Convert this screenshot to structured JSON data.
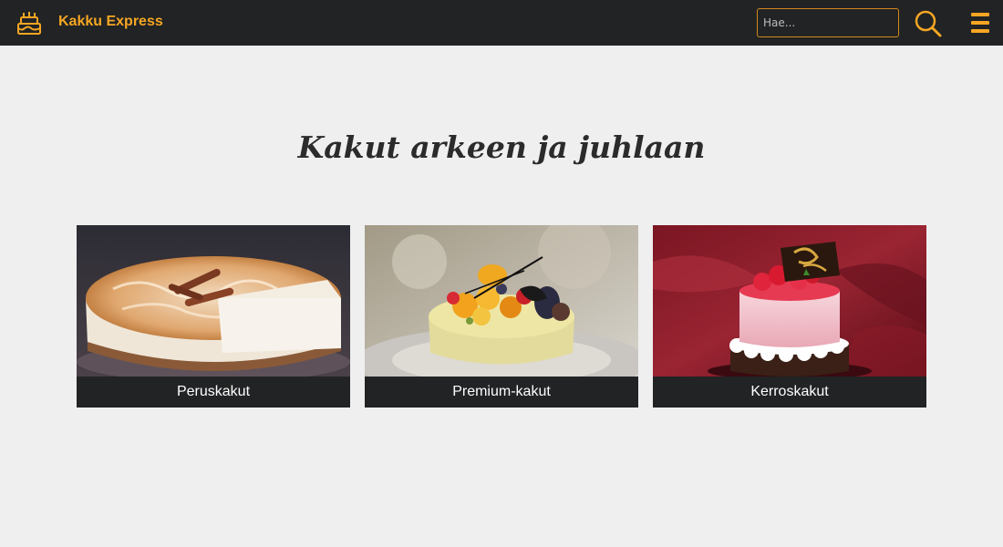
{
  "header": {
    "brand": "Kakku Express",
    "search_placeholder": "Hae...",
    "accent_color": "#f5a623",
    "logo_icon": "cake-icon",
    "search_icon": "search-icon",
    "menu_icon": "hamburger-menu-icon"
  },
  "main": {
    "title": "Kakut arkeen ja juhlaan"
  },
  "categories": [
    {
      "label": "Peruskakut",
      "image": "cheesecake-with-cinnamon-photo"
    },
    {
      "label": "Premium-kakut",
      "image": "fruit-topped-cake-photo"
    },
    {
      "label": "Kerroskakut",
      "image": "strawberry-mousse-cake-photo"
    }
  ]
}
